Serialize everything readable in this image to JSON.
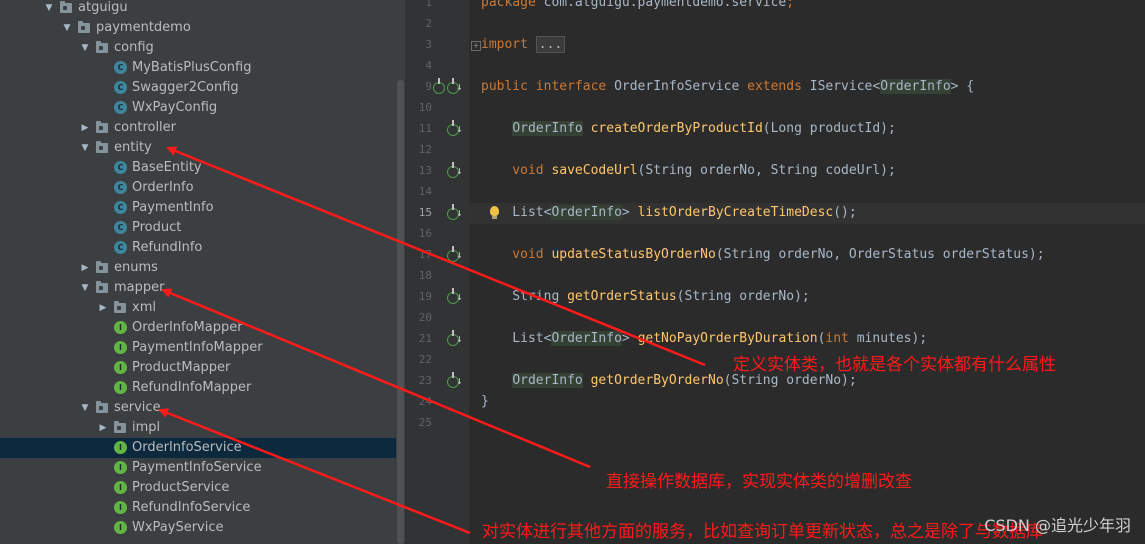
{
  "tree": [
    {
      "depth": 0,
      "kind": "folder",
      "arrow": "down",
      "label": "atguigu"
    },
    {
      "depth": 1,
      "kind": "folder",
      "arrow": "down",
      "label": "paymentdemo"
    },
    {
      "depth": 2,
      "kind": "folder",
      "arrow": "down",
      "label": "config"
    },
    {
      "depth": 3,
      "kind": "class",
      "label": "MyBatisPlusConfig"
    },
    {
      "depth": 3,
      "kind": "class",
      "label": "Swagger2Config"
    },
    {
      "depth": 3,
      "kind": "class",
      "label": "WxPayConfig"
    },
    {
      "depth": 2,
      "kind": "folder",
      "arrow": "right",
      "label": "controller"
    },
    {
      "depth": 2,
      "kind": "folder",
      "arrow": "down",
      "label": "entity"
    },
    {
      "depth": 3,
      "kind": "class",
      "label": "BaseEntity"
    },
    {
      "depth": 3,
      "kind": "class",
      "label": "OrderInfo"
    },
    {
      "depth": 3,
      "kind": "class",
      "label": "PaymentInfo"
    },
    {
      "depth": 3,
      "kind": "class",
      "label": "Product"
    },
    {
      "depth": 3,
      "kind": "class",
      "label": "RefundInfo"
    },
    {
      "depth": 2,
      "kind": "folder",
      "arrow": "right",
      "label": "enums"
    },
    {
      "depth": 2,
      "kind": "folder",
      "arrow": "down",
      "label": "mapper"
    },
    {
      "depth": 3,
      "kind": "folder",
      "arrow": "right",
      "label": "xml"
    },
    {
      "depth": 3,
      "kind": "interface",
      "label": "OrderInfoMapper"
    },
    {
      "depth": 3,
      "kind": "interface",
      "label": "PaymentInfoMapper"
    },
    {
      "depth": 3,
      "kind": "interface",
      "label": "ProductMapper"
    },
    {
      "depth": 3,
      "kind": "interface",
      "label": "RefundInfoMapper"
    },
    {
      "depth": 2,
      "kind": "folder",
      "arrow": "down",
      "label": "service"
    },
    {
      "depth": 3,
      "kind": "folder",
      "arrow": "right",
      "label": "impl"
    },
    {
      "depth": 3,
      "kind": "interface",
      "label": "OrderInfoService",
      "selected": true
    },
    {
      "depth": 3,
      "kind": "interface",
      "label": "PaymentInfoService"
    },
    {
      "depth": 3,
      "kind": "interface",
      "label": "ProductService"
    },
    {
      "depth": 3,
      "kind": "interface",
      "label": "RefundInfoService"
    },
    {
      "depth": 3,
      "kind": "interface",
      "label": "WxPayService"
    }
  ],
  "icons": {
    "class_glyph": "C",
    "interface_glyph": "I",
    "arrow_down": "▼",
    "arrow_right": "▶",
    "override_arrow": "↓"
  },
  "editor": {
    "current_line": 15,
    "lines": [
      {
        "n": 1,
        "parts": [
          [
            "kw",
            "package "
          ],
          [
            "",
            "com.atguigu.paymentdemo.service"
          ],
          [
            "kw",
            ";"
          ]
        ]
      },
      {
        "n": 2,
        "parts": []
      },
      {
        "n": 3,
        "parts": [
          [
            "kw",
            "import "
          ],
          [
            "folded",
            "..."
          ]
        ],
        "fold": true
      },
      {
        "n": 4,
        "parts": []
      },
      {
        "n": 9,
        "parts": [
          [
            "kw",
            "public interface "
          ],
          [
            "",
            "OrderInfoService "
          ],
          [
            "kw",
            "extends "
          ],
          [
            "",
            "IService<"
          ],
          [
            "hl",
            "OrderInfo"
          ],
          [
            "",
            "> {"
          ]
        ],
        "mark": "impl"
      },
      {
        "n": 10,
        "parts": []
      },
      {
        "n": 11,
        "parts": [
          [
            "",
            "    "
          ],
          [
            "hl",
            "OrderInfo"
          ],
          [
            "",
            ""
          ],
          [
            "fn",
            " createOrderByProductId"
          ],
          [
            "",
            "(Long productId);"
          ]
        ],
        "mark": "down"
      },
      {
        "n": 12,
        "parts": []
      },
      {
        "n": 13,
        "parts": [
          [
            "kw",
            "    void "
          ],
          [
            "fn",
            "saveCodeUrl"
          ],
          [
            "",
            "(String orderNo, String codeUrl);"
          ]
        ],
        "mark": "down"
      },
      {
        "n": 14,
        "parts": []
      },
      {
        "n": 15,
        "parts": [
          [
            "",
            "    List<"
          ],
          [
            "hl",
            "OrderInfo"
          ],
          [
            "",
            "> "
          ],
          [
            "fn",
            "listOrderByCreateTimeDesc"
          ],
          [
            "",
            "();"
          ]
        ],
        "mark": "down",
        "bulb": true
      },
      {
        "n": 16,
        "parts": []
      },
      {
        "n": 17,
        "parts": [
          [
            "kw",
            "    void "
          ],
          [
            "fn",
            "updateStatusByOrderNo"
          ],
          [
            "",
            "(String orderNo, OrderStatus orderStatus);"
          ]
        ],
        "mark": "down"
      },
      {
        "n": 18,
        "parts": []
      },
      {
        "n": 19,
        "parts": [
          [
            "",
            "    String "
          ],
          [
            "fn",
            "getOrderStatus"
          ],
          [
            "",
            "(String orderNo);"
          ]
        ],
        "mark": "down"
      },
      {
        "n": 20,
        "parts": []
      },
      {
        "n": 21,
        "parts": [
          [
            "",
            "    List<"
          ],
          [
            "hl",
            "OrderInfo"
          ],
          [
            "",
            "> "
          ],
          [
            "fn",
            "getNoPayOrderByDuration"
          ],
          [
            "",
            "("
          ],
          [
            "kw",
            "int "
          ],
          [
            "",
            "minutes);"
          ]
        ],
        "mark": "down"
      },
      {
        "n": 22,
        "parts": []
      },
      {
        "n": 23,
        "parts": [
          [
            "",
            "    "
          ],
          [
            "hl",
            "OrderInfo"
          ],
          [
            "fn",
            " getOrderByOrderNo"
          ],
          [
            "",
            "(String orderNo);"
          ]
        ],
        "mark": "down"
      },
      {
        "n": 24,
        "parts": [
          [
            "",
            "}"
          ]
        ]
      },
      {
        "n": 25,
        "parts": []
      }
    ]
  },
  "annotations": [
    {
      "id": "entity",
      "text": "定义实体类，也就是各个实体都有什么属性"
    },
    {
      "id": "mapper",
      "text": "直接操作数据库，实现实体类的增删改查"
    },
    {
      "id": "service",
      "text": "对实体进行其他方面的服务，比如查询订单更新状态，总之是除了与数据库"
    }
  ],
  "watermark": "CSDN @追光少年羽",
  "colors": {
    "annotation": "#ff1a1a",
    "selection": "#0d293e"
  }
}
